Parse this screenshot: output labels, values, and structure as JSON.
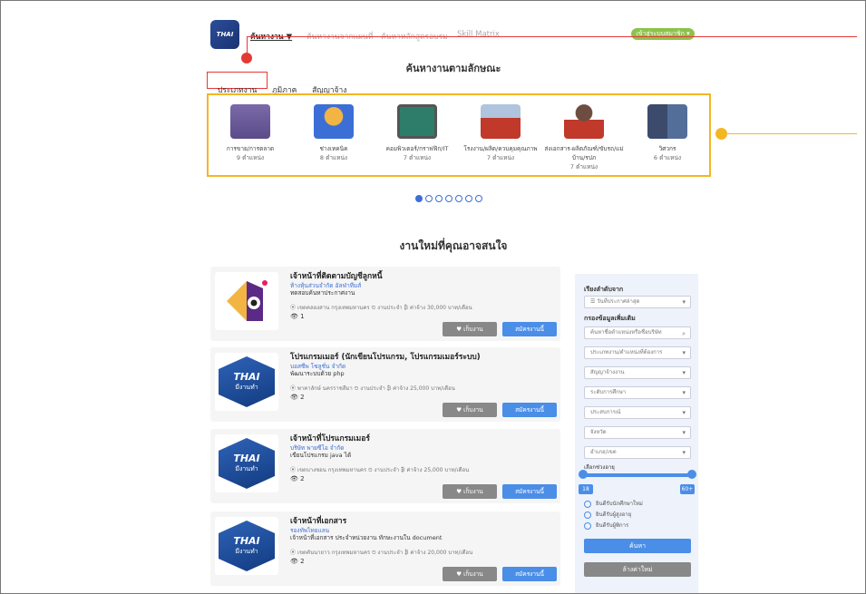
{
  "header": {
    "logo_text": "THAI",
    "nav": [
      "ค้นหางาน ▼",
      "ค้นหางานจากแผนที่",
      "ค้นหาหลักสูตรอบรม",
      "Skill Matrix"
    ],
    "member_button": "เข้าสู่ระบบสมาชิก ▾"
  },
  "search_section": {
    "title": "ค้นหางานตามลักษณะ",
    "tabs": [
      "ประเภทงาน",
      "ภูมิภาค",
      "สัญญาจ้าง"
    ],
    "categories": [
      {
        "name": "การขาย/การตลาด",
        "count": "9 ตำแหน่ง"
      },
      {
        "name": "ช่างเทคนิค",
        "count": "8 ตำแหน่ง"
      },
      {
        "name": "คอมพิวเตอร์/กราฟฟิก/IT",
        "count": "7 ตำแหน่ง"
      },
      {
        "name": "โรงงาน/ผลิต/ควบคุมคุณภาพ",
        "count": "7 ตำแหน่ง"
      },
      {
        "name": "ส่งเอกสาร-ผลิตภัณฑ์/ขับรถ/แม่บ้าน/รปภ",
        "count": "7 ตำแหน่ง"
      },
      {
        "name": "วิศวกร",
        "count": "6 ตำแหน่ง"
      }
    ]
  },
  "recommend": {
    "title": "งานใหม่ที่คุณอาจสนใจ",
    "favorite_label": "♥ เก็บงาน",
    "apply_label": "สมัครงานนี้",
    "jobs": [
      {
        "title": "เจ้าหน้าที่ติดตามบัญชีลูกหนี้",
        "company": "ห้างหุ้นส่วนจำกัด อัลฟ่าทีมส์",
        "desc": "ทดสอบค้นหาประกาศงาน",
        "meta": "⦿ เขตคลองสาน กรุงเทพมหานคร  ⏲ งานประจำ  ₿ ค่าจ้าง 30,000 บาท/เดือน",
        "views": "👁 1"
      },
      {
        "title": "โปรแกรมเมอร์ (นักเขียนโปรแกรม, โปรแกรมเมอร์ระบบ)",
        "company": "บอสซีพ โซลูชั่น จำกัด",
        "desc": "พัฒนาระบบด้วย php",
        "meta": "⦿ พาคาลักษ์ นครราชสีมา  ⏲ งานประจำ  ₿ ค่าจ้าง 25,000 บาท/เดือน",
        "views": "👁 2"
      },
      {
        "title": "เจ้าหน้าที่โปรแกรมเมอร์",
        "company": "บริษัท พายซีโอ จำกัด",
        "desc": "เขียนโปรแกรม java ได้",
        "meta": "⦿ เขตบางซอน กรุงเทพมหานคร  ⏲ งานประจำ  ₿ ค่าจ้าง 25,000 บาท/เดือน",
        "views": "👁 2"
      },
      {
        "title": "เจ้าหน้าที่เอกสาร",
        "company": "รองทัพไทยแลน",
        "desc": "เจ้าหน้าที่เอกสาร ประจำหน่วยงาน ทักษะงานใน document",
        "meta": "⦿ เขตคันนายาว กรุงเทพมหานคร  ⏲ งานประจำ  ₿ ค่าจ้าง 20,000 บาท/เดือน",
        "views": "👁 2"
      }
    ]
  },
  "sidebar": {
    "sort_label": "เรียงลำดับจาก",
    "sort_value": "☰ วันที่ประกาศล่าสุด",
    "filter_label": "กรองข้อมูลเพิ่มเติม",
    "search_placeholder": "ค้นหาชื่อตำแหน่งหรือชื่อบริษัท",
    "selects": [
      "ประเภทงาน/ตำแหน่งที่ต้องการ",
      "สัญญาจ้างงาน",
      "ระดับการศึกษา",
      "ประสบการณ์",
      "จังหวัด",
      "อำเภอ/เขต"
    ],
    "age_label": "เลือกช่วงอายุ",
    "age_min": "18",
    "age_max": "60+",
    "radios": [
      "ยินดีรับนักศึกษาใหม่",
      "ยินดีรับผู้สูงอายุ",
      "ยินดีรับผู้พิการ"
    ],
    "search_button": "ค้นหา",
    "clear_button": "ล้างค่าใหม่"
  },
  "colors": {
    "annotation_red": "#e53935",
    "annotation_yellow": "#f5b623",
    "primary_blue": "#4a8ee8"
  }
}
